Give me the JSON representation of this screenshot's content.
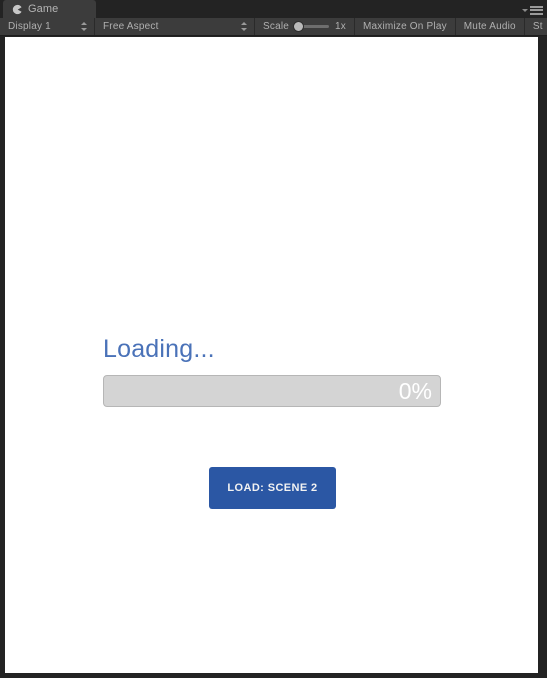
{
  "window": {
    "tab": {
      "label": "Game",
      "icon": "game-controller-icon"
    },
    "menu": {
      "icon": "hamburger-menu-icon",
      "caret_icon": "dropdown-caret-icon"
    }
  },
  "toolbar": {
    "display": {
      "label": "Display 1",
      "dropdown_icon": "updown-arrows-icon"
    },
    "aspect": {
      "label": "Free Aspect",
      "dropdown_icon": "updown-arrows-icon"
    },
    "scale": {
      "label": "Scale",
      "value": "1x",
      "slider_position_percent": 0
    },
    "maximize_on_play": "Maximize On Play",
    "mute_audio": "Mute Audio",
    "stats": "St"
  },
  "game": {
    "loading_title": "Loading...",
    "progress": {
      "percent_text": "0%",
      "percent_value": 0
    },
    "load_button": {
      "label": "LOAD: SCENE 2"
    }
  },
  "colors": {
    "accent_blue": "#2b57a4",
    "loading_text_blue": "#4a72b8",
    "progress_track": "#d4d4d4",
    "progress_border": "#b6b6b6",
    "editor_chrome": "#3c3c3c",
    "editor_background": "#232323",
    "game_canvas": "#ffffff"
  }
}
